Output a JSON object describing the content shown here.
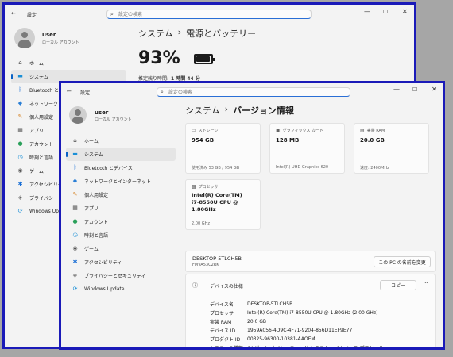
{
  "back_window": {
    "app_title": "設定",
    "search_placeholder": "設定の検索",
    "user_name": "user",
    "account_type": "ローカル アカウント",
    "breadcrumb_parent": "システム",
    "breadcrumb_sep": "›",
    "breadcrumb_current": "電源とバッテリー",
    "battery_percent": "93%",
    "battery_level": 0.93,
    "remaining_label": "推定残り時間:",
    "remaining_value": "1 時間 44 分",
    "nav": [
      {
        "label": "ホーム",
        "icon": "home-icon",
        "glyph": "⌂",
        "color": "#444"
      },
      {
        "label": "システム",
        "icon": "system-icon",
        "glyph": "▬",
        "color": "#1a8fd6",
        "active": true
      },
      {
        "label": "Bluetooth とデバ",
        "icon": "bluetooth-icon",
        "glyph": "ᛒ",
        "color": "#1a6fd6"
      },
      {
        "label": "ネットワークとイ",
        "icon": "network-icon",
        "glyph": "◆",
        "color": "#2a7fd6"
      },
      {
        "label": "個人用設定",
        "icon": "personalization-icon",
        "glyph": "✎",
        "color": "#d6862a"
      },
      {
        "label": "アプリ",
        "icon": "apps-icon",
        "glyph": "▦",
        "color": "#555"
      },
      {
        "label": "アカウント",
        "icon": "accounts-icon",
        "glyph": "●",
        "color": "#2aa05a"
      },
      {
        "label": "時刻と言語",
        "icon": "time-language-icon",
        "glyph": "◷",
        "color": "#1a8fd6"
      },
      {
        "label": "ゲーム",
        "icon": "gaming-icon",
        "glyph": "◉",
        "color": "#555"
      },
      {
        "label": "アクセシビリティ",
        "icon": "accessibility-icon",
        "glyph": "✱",
        "color": "#1a6fd6"
      },
      {
        "label": "プライバシーとセ",
        "icon": "privacy-icon",
        "glyph": "◈",
        "color": "#666"
      },
      {
        "label": "Windows Upda",
        "icon": "windows-update-icon",
        "glyph": "⟳",
        "color": "#1a8fd6"
      }
    ]
  },
  "front_window": {
    "app_title": "設定",
    "search_placeholder": "設定の検索",
    "user_name": "user",
    "account_type": "ローカル アカウント",
    "breadcrumb_parent": "システム",
    "breadcrumb_sep": "›",
    "breadcrumb_current": "バージョン情報",
    "nav": [
      {
        "label": "ホーム",
        "icon": "home-icon",
        "glyph": "⌂",
        "color": "#444"
      },
      {
        "label": "システム",
        "icon": "system-icon",
        "glyph": "▬",
        "color": "#1a8fd6",
        "active": true
      },
      {
        "label": "Bluetooth とデバイス",
        "icon": "bluetooth-icon",
        "glyph": "ᛒ",
        "color": "#1a6fd6"
      },
      {
        "label": "ネットワークとインターネット",
        "icon": "network-icon",
        "glyph": "◆",
        "color": "#2a7fd6"
      },
      {
        "label": "個人用設定",
        "icon": "personalization-icon",
        "glyph": "✎",
        "color": "#d6862a"
      },
      {
        "label": "アプリ",
        "icon": "apps-icon",
        "glyph": "▦",
        "color": "#555"
      },
      {
        "label": "アカウント",
        "icon": "accounts-icon",
        "glyph": "●",
        "color": "#2aa05a"
      },
      {
        "label": "時刻と言語",
        "icon": "time-language-icon",
        "glyph": "◷",
        "color": "#1a8fd6"
      },
      {
        "label": "ゲーム",
        "icon": "gaming-icon",
        "glyph": "◉",
        "color": "#555"
      },
      {
        "label": "アクセシビリティ",
        "icon": "accessibility-icon",
        "glyph": "✱",
        "color": "#1a6fd6"
      },
      {
        "label": "プライバシーとセキュリティ",
        "icon": "privacy-icon",
        "glyph": "◈",
        "color": "#666"
      },
      {
        "label": "Windows Update",
        "icon": "windows-update-icon",
        "glyph": "⟳",
        "color": "#1a8fd6"
      }
    ],
    "cards": {
      "storage": {
        "title": "ストレージ",
        "value": "954 GB",
        "sub": "使用済み 53 GB / 954 GB"
      },
      "graphics": {
        "title": "グラフィックス カード",
        "value": "128 MB",
        "sub": "Intel(R) UHD Graphics 620"
      },
      "ram": {
        "title": "実装 RAM",
        "value": "20.0 GB",
        "sub": "速度: 2400MHz"
      },
      "processor": {
        "title": "プロセッサ",
        "value_lines": [
          "Intel(R) Core(TM)",
          "i7-8550U CPU @",
          "1.80GHz"
        ],
        "sub": "2.00 GHz"
      }
    },
    "device": {
      "name": "DESKTOP-5TLCH5B",
      "model": "FMVA53C2RK",
      "rename_button": "この PC の名前を変更"
    },
    "spec": {
      "title": "デバイスの仕様",
      "copy_button": "コピー",
      "rows": [
        {
          "k": "デバイス名",
          "v": "DESKTOP-5TLCH5B"
        },
        {
          "k": "プロセッサ",
          "v": "Intel(R) Core(TM) i7-8550U CPU @ 1.80GHz (2.00 GHz)"
        },
        {
          "k": "実装 RAM",
          "v": "20.0 GB"
        },
        {
          "k": "デバイス ID",
          "v": "1959A056-4D9C-4F71-9204-856D11EF9E77"
        },
        {
          "k": "プロダクト ID",
          "v": "00325-96300-10381-AAOEM"
        },
        {
          "k": "システムの種類",
          "v": "64 ビット オペレーティング システム、x64 ベース プロセッサ"
        }
      ]
    }
  }
}
